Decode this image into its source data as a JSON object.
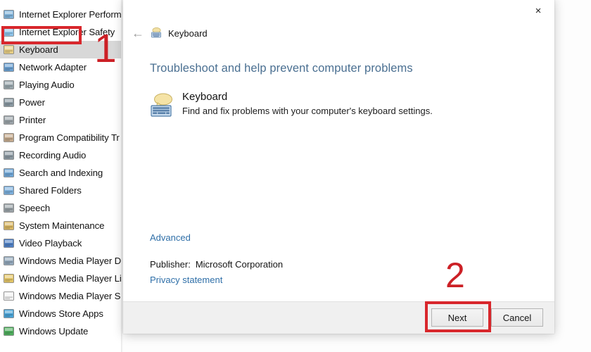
{
  "sidebar": {
    "items": [
      {
        "label": "Internet Explorer Performa",
        "icon": "internet-explorer-icon",
        "color": "#7fb2d9",
        "selected": false
      },
      {
        "label": "Internet Explorer Safety",
        "icon": "internet-explorer-safety-icon",
        "color": "#8ec4ea",
        "selected": false
      },
      {
        "label": "Keyboard",
        "icon": "keyboard-icon",
        "color": "#e8cf84",
        "selected": true
      },
      {
        "label": "Network Adapter",
        "icon": "network-adapter-icon",
        "color": "#6a9fd0",
        "selected": false
      },
      {
        "label": "Playing Audio",
        "icon": "playing-audio-icon",
        "color": "#9aa7ad",
        "selected": false
      },
      {
        "label": "Power",
        "icon": "power-icon",
        "color": "#8b9aa3",
        "selected": false
      },
      {
        "label": "Printer",
        "icon": "printer-icon",
        "color": "#9ba4a9",
        "selected": false
      },
      {
        "label": "Program Compatibility Tr",
        "icon": "program-compatibility-icon",
        "color": "#c3a98c",
        "selected": false
      },
      {
        "label": "Recording Audio",
        "icon": "recording-audio-icon",
        "color": "#8d9aa2",
        "selected": false
      },
      {
        "label": "Search and Indexing",
        "icon": "search-indexing-icon",
        "color": "#6fa6d6",
        "selected": false
      },
      {
        "label": "Shared Folders",
        "icon": "shared-folders-icon",
        "color": "#7db0dd",
        "selected": false
      },
      {
        "label": "Speech",
        "icon": "speech-icon",
        "color": "#9aa2a7",
        "selected": false
      },
      {
        "label": "System Maintenance",
        "icon": "system-maintenance-icon",
        "color": "#d9b764",
        "selected": false
      },
      {
        "label": "Video Playback",
        "icon": "video-playback-icon",
        "color": "#4f80c4",
        "selected": false
      },
      {
        "label": "Windows Media Player DV",
        "icon": "media-player-dvd-icon",
        "color": "#93a8bb",
        "selected": false
      },
      {
        "label": "Windows Media Player Lib",
        "icon": "media-player-library-icon",
        "color": "#e3c566",
        "selected": false
      },
      {
        "label": "Windows Media Player Se",
        "icon": "media-player-settings-icon",
        "color": "#f2f2f2",
        "selected": false
      },
      {
        "label": "Windows Store Apps",
        "icon": "windows-store-apps-icon",
        "color": "#4aa3d6",
        "selected": false
      },
      {
        "label": "Windows Update",
        "icon": "windows-update-icon",
        "color": "#4fae5e",
        "selected": false
      }
    ]
  },
  "dialog": {
    "close_label": "×",
    "back_label": "←",
    "nav_title": "Keyboard",
    "heading": "Troubleshoot and help prevent computer problems",
    "tool": {
      "name": "Keyboard",
      "description": "Find and fix problems with your computer's keyboard settings."
    },
    "advanced_label": "Advanced",
    "publisher_label": "Publisher:",
    "publisher_value": "Microsoft Corporation",
    "privacy_label": "Privacy statement",
    "buttons": {
      "next": "Next",
      "cancel": "Cancel"
    }
  },
  "annotations": {
    "step_one": "1",
    "step_two": "2",
    "color": "#cc2026"
  }
}
